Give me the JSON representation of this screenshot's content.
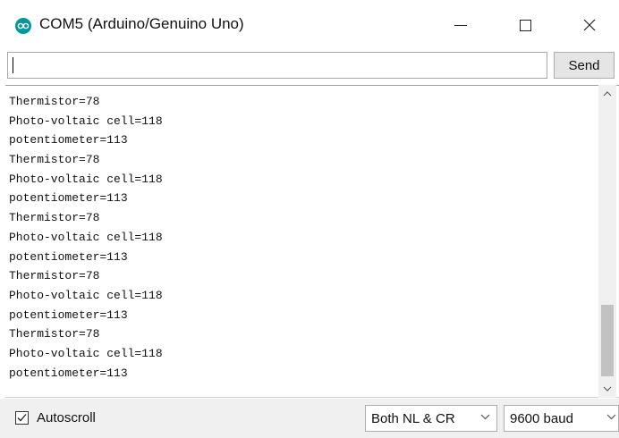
{
  "window": {
    "title": "COM5 (Arduino/Genuino Uno)",
    "icon": "arduino-logo-icon",
    "controls": [
      "minimize-icon",
      "maximize-icon",
      "close-icon"
    ]
  },
  "input": {
    "value": "",
    "send_label": "Send"
  },
  "output": {
    "lines": [
      "Thermistor=78",
      "Photo-voltaic cell=118",
      "potentiometer=113",
      "Thermistor=78",
      "Photo-voltaic cell=118",
      "potentiometer=113",
      "Thermistor=78",
      "Photo-voltaic cell=118",
      "potentiometer=113",
      "Thermistor=78",
      "Photo-voltaic cell=118",
      "potentiometer=113",
      "Thermistor=78",
      "Photo-voltaic cell=118",
      "potentiometer=113"
    ]
  },
  "footer": {
    "autoscroll_label": "Autoscroll",
    "autoscroll_checked": true,
    "line_ending": "Both NL & CR",
    "baud_rate": "9600 baud"
  },
  "colors": {
    "accent": "#00979d",
    "button_bg": "#e5e5e5",
    "footer_bg": "#f0f0f0"
  }
}
